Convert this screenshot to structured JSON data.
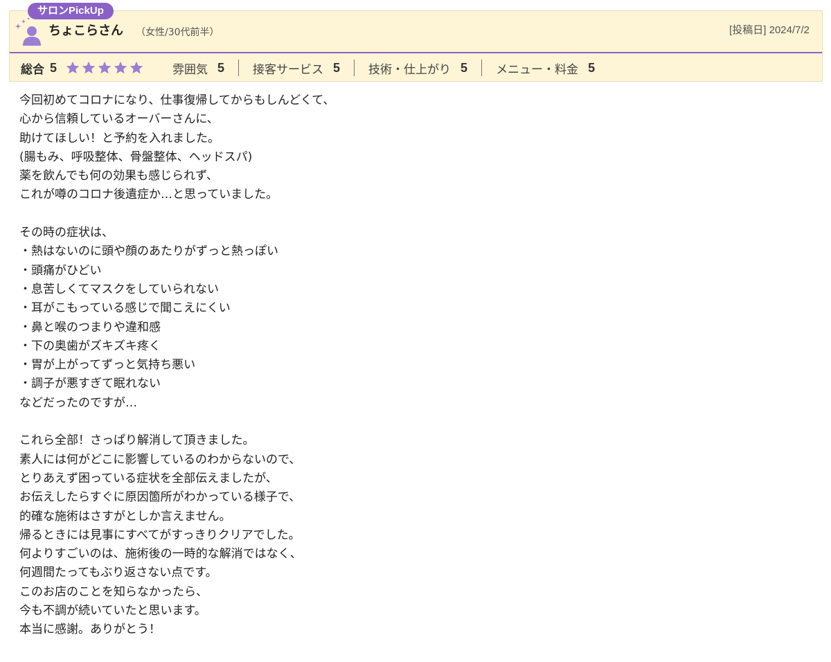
{
  "review": {
    "badge": "サロンPickUp",
    "reviewer_name": "ちょこらさん",
    "reviewer_attr": "（女性/30代前半）",
    "post_date": "[投稿日] 2024/7/2",
    "overall_label": "総合",
    "overall_score": "5",
    "stars_filled": 5,
    "stars_total": 5,
    "categories": [
      {
        "label": "雰囲気",
        "score": "5"
      },
      {
        "label": "接客サービス",
        "score": "5"
      },
      {
        "label": "技術・仕上がり",
        "score": "5"
      },
      {
        "label": "メニュー・料金",
        "score": "5"
      }
    ],
    "body": "今回初めてコロナになり、仕事復帰してからもしんどくて、\n心から信頼しているオーバーさんに、\n助けてほしい！と予約を入れました。\n(腸もみ、呼吸整体、骨盤整体、ヘッドスパ)\n薬を飲んでも何の効果も感じられず、\nこれが噂のコロナ後遺症か…と思っていました。\n\nその時の症状は、\n・熱はないのに頭や顔のあたりがずっと熱っぽい\n・頭痛がひどい\n・息苦しくてマスクをしていられない\n・耳がこもっている感じで聞こえにくい\n・鼻と喉のつまりや違和感\n・下の奥歯がズキズキ疼く\n・胃が上がってずっと気持ち悪い\n・調子が悪すぎて眠れない\nなどだったのですが…\n\nこれら全部！さっぱり解消して頂きました。\n素人には何がどこに影響しているのわからないので、\nとりあえず困っている症状を全部伝えましたが、\nお伝えしたらすぐに原因箇所がわかっている様子で、\n的確な施術はさすがとしか言えません。\n帰るときには見事にすべてがすっきりクリアでした。\n何よりすごいのは、施術後の一時的な解消ではなく、\n何週間たってもぶり返さない点です。\nこのお店のことを知らなかったら、\n今も不調が続いていたと思います。\n本当に感謝。ありがとう！"
  },
  "colors": {
    "accent": "#8a62c7",
    "header_bg": "#fdf5d6",
    "star": "#9b7fd4"
  }
}
